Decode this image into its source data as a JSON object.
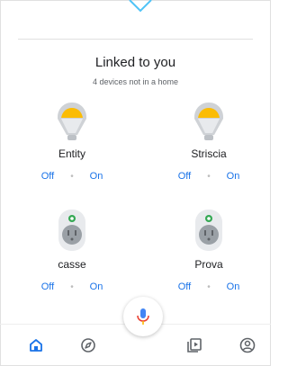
{
  "header": {
    "title": "Linked to you",
    "subtitle": "4 devices not in a home"
  },
  "devices": [
    {
      "name": "Entity",
      "type": "bulb-icon",
      "off_label": "Off",
      "on_label": "On"
    },
    {
      "name": "Striscia",
      "type": "bulb-icon",
      "off_label": "Off",
      "on_label": "On"
    },
    {
      "name": "casse",
      "type": "plug-icon",
      "off_label": "Off",
      "on_label": "On"
    },
    {
      "name": "Prova",
      "type": "plug-icon",
      "off_label": "Off",
      "on_label": "On"
    }
  ],
  "colors": {
    "accent": "#1a73e8",
    "bulb_light": "#fbbc04",
    "plug_indicator": "#34a853",
    "mic_red": "#ea4335"
  },
  "bottom_nav": {
    "items": [
      "home-icon",
      "explore-icon",
      "media-icon",
      "account-icon"
    ],
    "active": "home-icon"
  }
}
